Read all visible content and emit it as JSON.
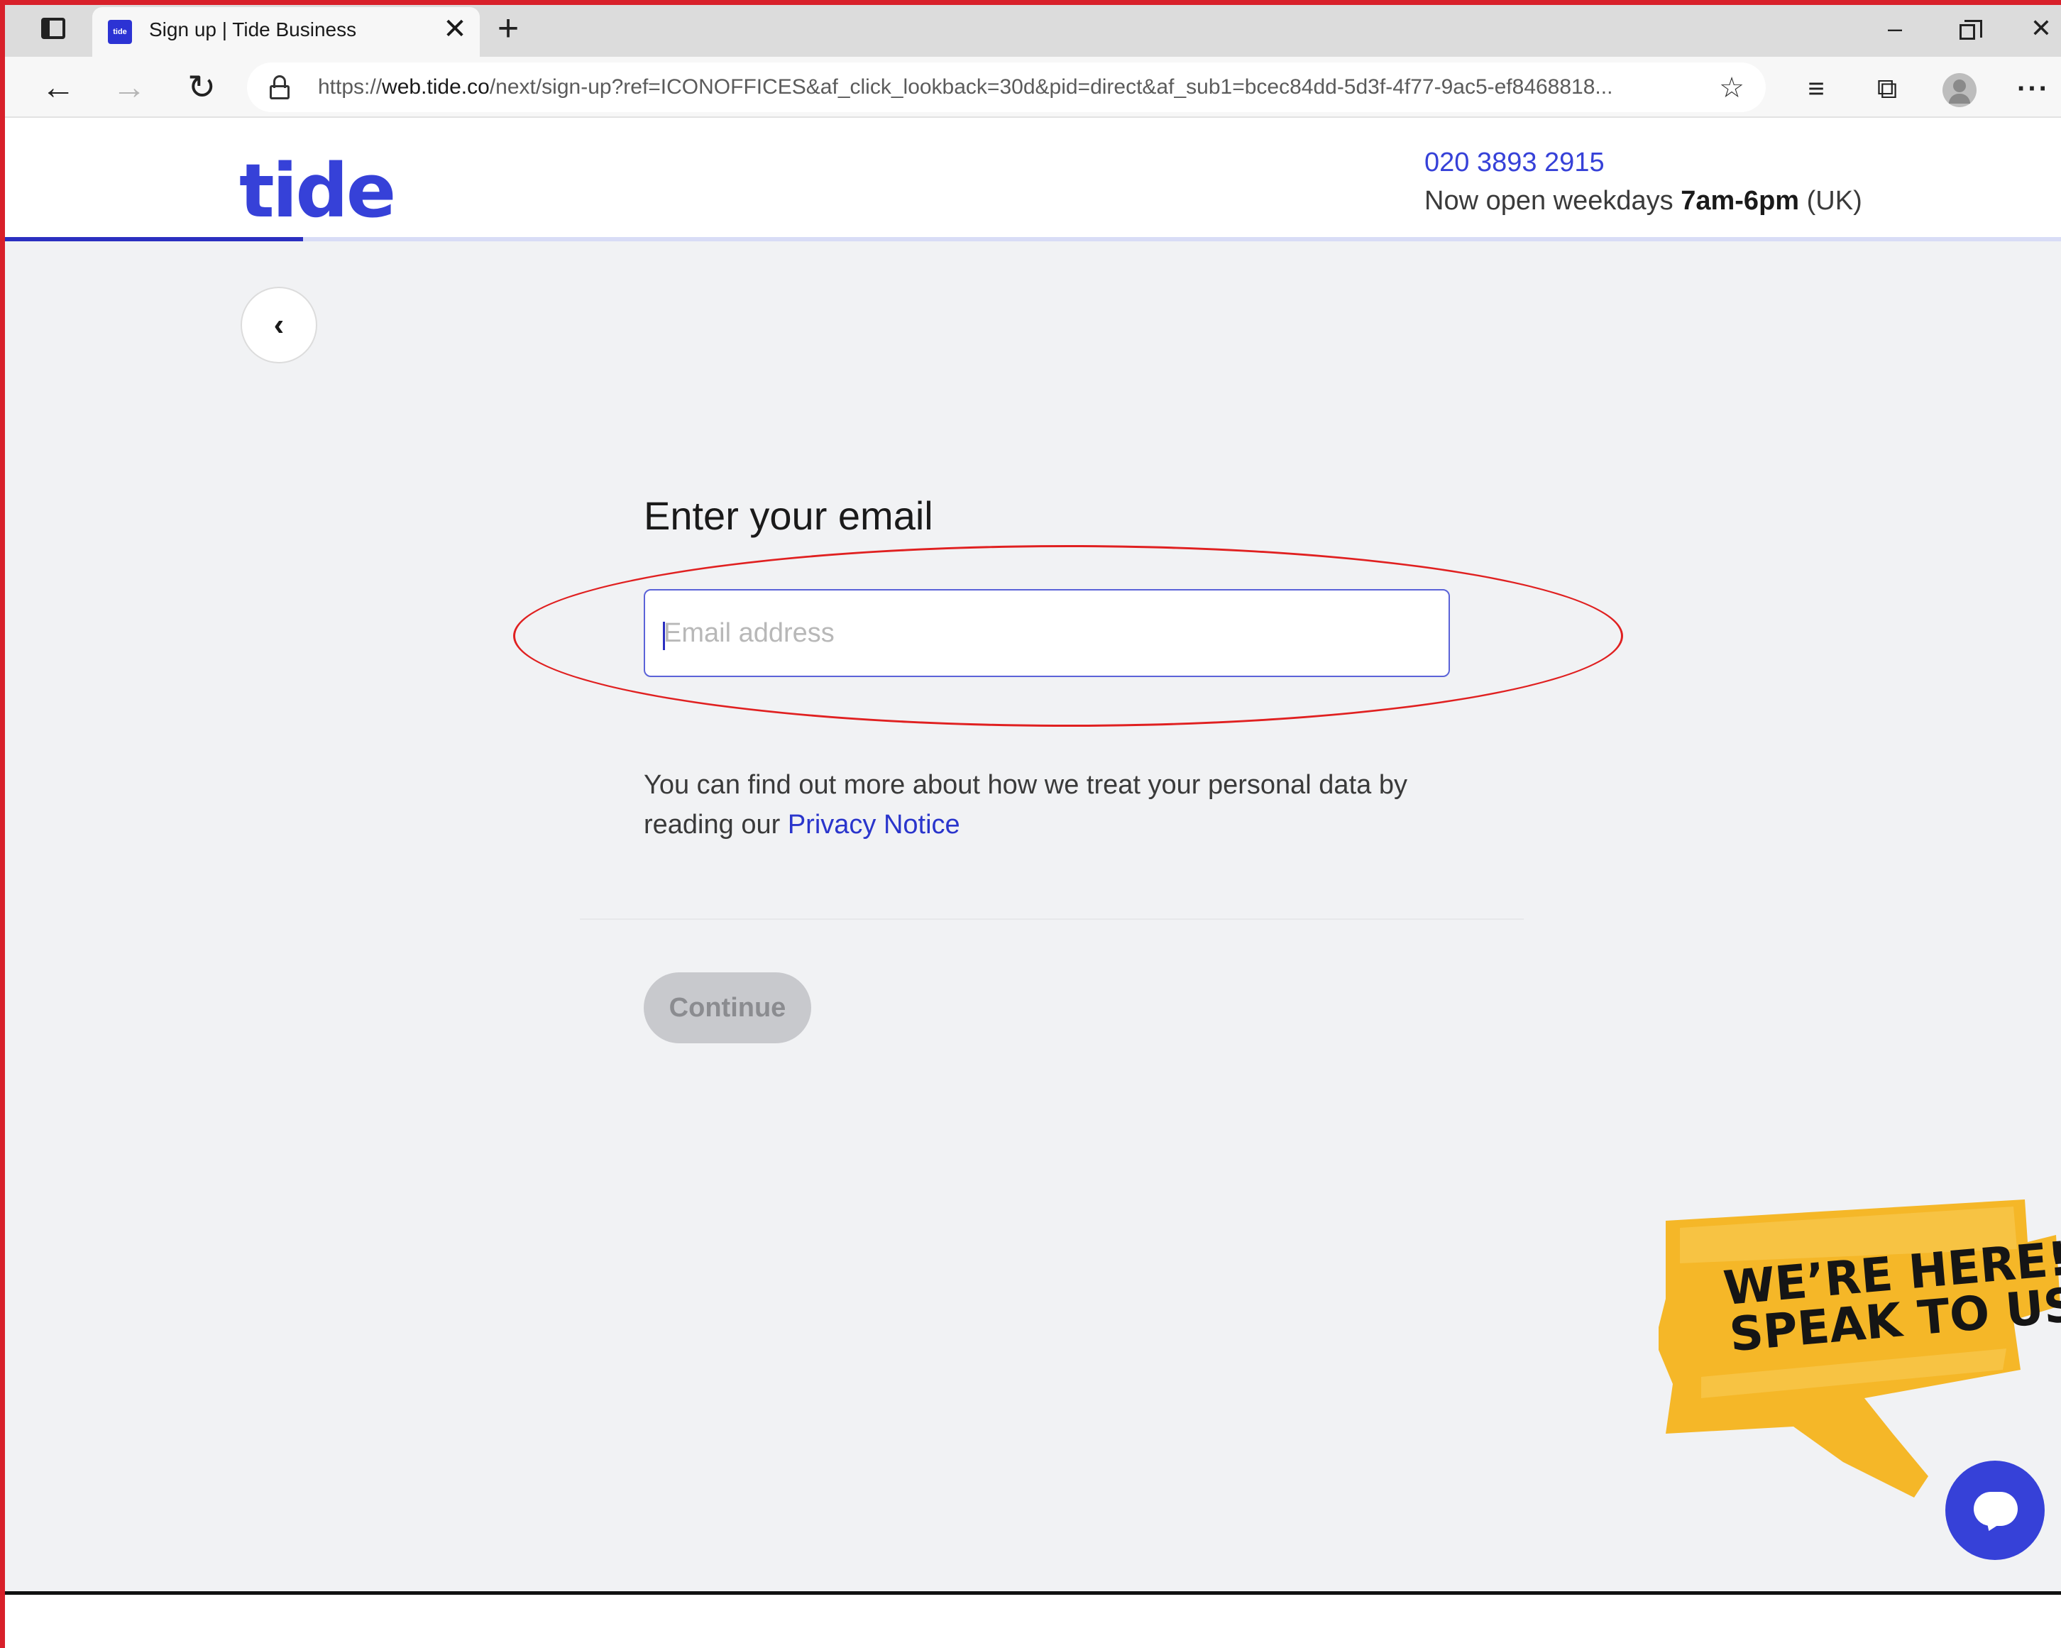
{
  "browser": {
    "tab": {
      "favicon_text": "tide",
      "title": "Sign up | Tide Business",
      "close_glyph": "✕"
    },
    "new_tab_glyph": "+",
    "window": {
      "minimize_glyph": "–",
      "close_glyph": "✕"
    },
    "nav": {
      "back_glyph": "←",
      "forward_glyph": "→",
      "reload_glyph": "↻"
    },
    "address": {
      "url_prefix": "https://",
      "url_host": "web.tide.co",
      "url_rest": "/next/sign-up?ref=ICONOFFICES&af_click_lookback=30d&pid=direct&af_sub1=bcec84dd-5d3f-4f77-9ac5-ef8468818..."
    },
    "toolbar_icons": [
      "add-favorite-icon",
      "favorites-icon",
      "collections-icon",
      "profile-avatar",
      "more-icon"
    ],
    "icon_glyphs": {
      "add_favorite": "☆",
      "favorites": "≡",
      "collections": "⧉",
      "more": "···"
    }
  },
  "header": {
    "logo": "tide",
    "phone": "020 3893 2915",
    "hours_prefix": "Now open weekdays ",
    "hours_bold": "7am-6pm",
    "hours_suffix": " (UK)",
    "progress_fraction": 0.145
  },
  "form": {
    "back_glyph": "‹",
    "heading": "Enter your email",
    "email_placeholder": "Email address",
    "email_value": "",
    "privacy_text": "You can find out more about how we treat your personal data by reading our ",
    "privacy_link": "Privacy Notice",
    "continue_label": "Continue",
    "continue_enabled": false
  },
  "promo": {
    "line1": "WE’RE HERE!",
    "line2": "SPEAK TO US"
  },
  "colors": {
    "brand": "#3641d8",
    "annotation": "#e02020",
    "promo_yellow": "#f5b728",
    "page_bg": "#f1f2f4"
  }
}
